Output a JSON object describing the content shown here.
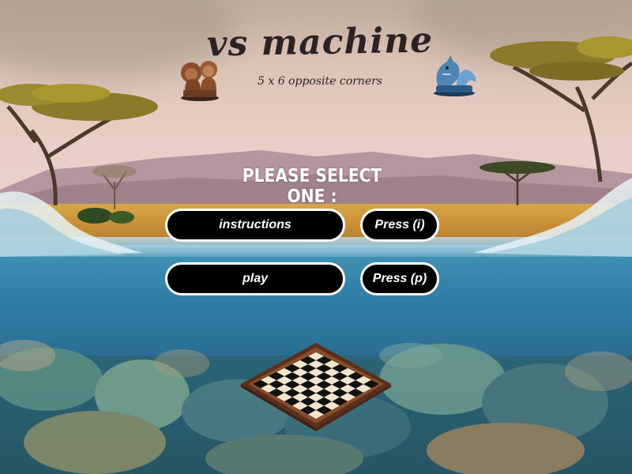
{
  "title": "vs machine",
  "subtitle": "5 x 6 opposite corners",
  "prompt": "PLEASE SELECT ONE :",
  "menu": {
    "instructions_label": "instructions",
    "instructions_key": "Press (i)",
    "play_label": "play",
    "play_key": "Press (p)"
  },
  "icons": {
    "left_piece": "lion-chess-piece-icon",
    "right_piece": "shark-chess-piece-icon",
    "board": "chessboard-icon"
  },
  "colors": {
    "button_bg": "#000000",
    "button_border": "#ffffff",
    "button_text": "#ffffff",
    "prompt_text": "#ffffff",
    "title_text": "#2b2323"
  }
}
